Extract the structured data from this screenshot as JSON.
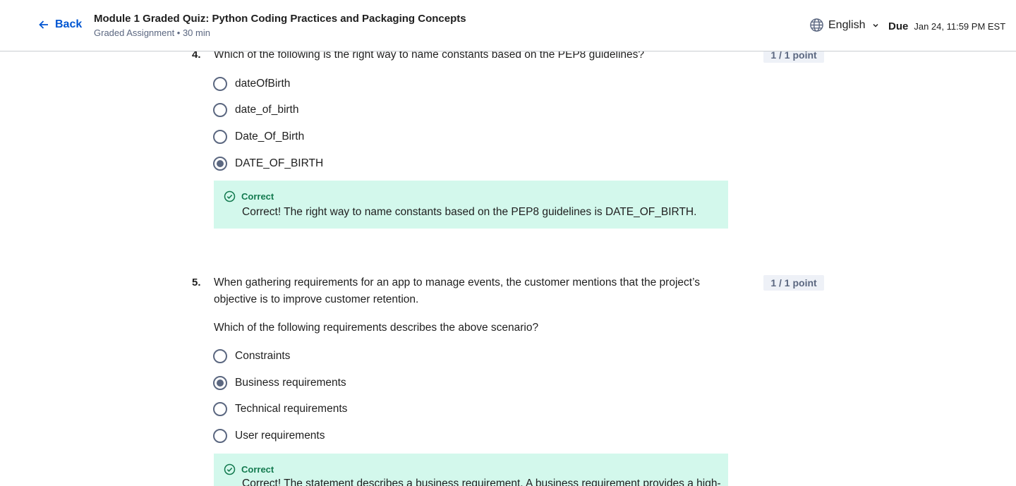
{
  "header": {
    "back_label": "Back",
    "title": "Module 1 Graded Quiz: Python Coding Practices and Packaging Concepts",
    "subtitle": "Graded Assignment • 30 min",
    "language": "English",
    "due_label": "Due",
    "due_value": "Jan 24, 11:59 PM EST"
  },
  "questions": [
    {
      "number": "4.",
      "text": "Which of the following is the right way to name constants based on the PEP8 guidelines?",
      "points": "1 / 1 point",
      "options": [
        {
          "label": "dateOfBirth",
          "selected": false
        },
        {
          "label": "date_of_birth",
          "selected": false
        },
        {
          "label": "Date_Of_Birth",
          "selected": false
        },
        {
          "label": "DATE_OF_BIRTH",
          "selected": true
        }
      ],
      "feedback": {
        "status": "Correct",
        "text": "Correct! The right way to name constants based on the PEP8 guidelines is DATE_OF_BIRTH."
      }
    },
    {
      "number": "5.",
      "text": "When gathering requirements for an app to manage events, the customer mentions that the project’s objective is to improve customer retention.",
      "prompt": "Which of the following requirements describes the above scenario?",
      "points": "1 / 1 point",
      "options": [
        {
          "label": "Constraints",
          "selected": false
        },
        {
          "label": "Business requirements",
          "selected": true
        },
        {
          "label": "Technical requirements",
          "selected": false
        },
        {
          "label": "User requirements",
          "selected": false
        }
      ],
      "feedback": {
        "status": "Correct",
        "text": "Correct! The statement describes a business requirement. A business requirement provides a high-"
      }
    }
  ],
  "colors": {
    "accent": "#0056d2",
    "correct_bg": "#d3f8ec",
    "correct_text": "#137a4f",
    "points_bg": "#eef1f7"
  }
}
